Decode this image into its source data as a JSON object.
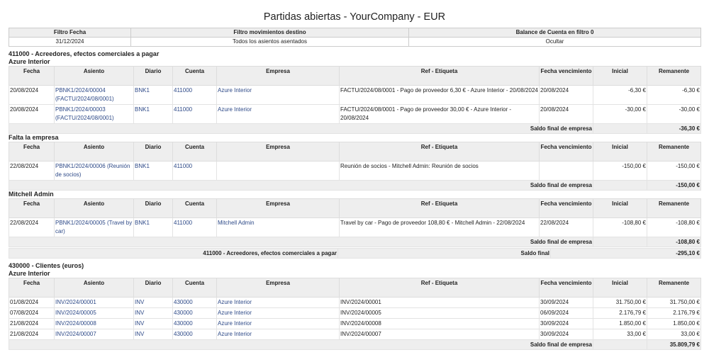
{
  "title": "Partidas abiertas - YourCompany - EUR",
  "filters": {
    "headers": [
      "Filtro Fecha",
      "Filtro movimientos destino",
      "Balance de Cuenta en filtro 0"
    ],
    "values": [
      "31/12/2024",
      "Todos los asientos asentados",
      "Ocultar"
    ]
  },
  "columns": [
    "Fecha",
    "Asiento",
    "Diario",
    "Cuenta",
    "Empresa",
    "Ref - Etiqueta",
    "Fecha vencimiento",
    "Inicial",
    "Remanente"
  ],
  "labels": {
    "partner_total": "Saldo final de empresa",
    "account_total": "Saldo final"
  },
  "accounts": [
    {
      "code": "411000",
      "name": "- Acreedores, efectos comerciales a pagar",
      "total_label": "411000 - Acreedores, efectos comerciales a pagar",
      "total": "-295,10 €",
      "partners": [
        {
          "name": "Azure Interior",
          "total": "-36,30 €",
          "rows": [
            {
              "fecha": "20/08/2024",
              "asiento": "PBNK1/2024/00004 (FACTU/2024/08/0001)",
              "diario": "BNK1",
              "cuenta": "411000",
              "empresa": "Azure Interior",
              "ref": "FACTU/2024/08/0001 - Pago de proveedor 6,30 € - Azure Interior - 20/08/2024",
              "venc": "20/08/2024",
              "inicial": "-6,30 €",
              "remanente": "-6,30 €"
            },
            {
              "fecha": "20/08/2024",
              "asiento": "PBNK1/2024/00003 (FACTU/2024/08/0001)",
              "diario": "BNK1",
              "cuenta": "411000",
              "empresa": "Azure Interior",
              "ref": "FACTU/2024/08/0001 - Pago de proveedor 30,00 € - Azure Interior - 20/08/2024",
              "venc": "20/08/2024",
              "inicial": "-30,00 €",
              "remanente": "-30,00 €"
            }
          ]
        },
        {
          "name": "Falta la empresa",
          "total": "-150,00 €",
          "rows": [
            {
              "fecha": "22/08/2024",
              "asiento": "PBNK1/2024/00006 (Reunión de socios)",
              "diario": "BNK1",
              "cuenta": "411000",
              "empresa": "",
              "ref": "Reunión de socios - Mitchell Admin: Reunión de socios",
              "venc": "",
              "inicial": "-150,00 €",
              "remanente": "-150,00 €"
            }
          ]
        },
        {
          "name": "Mitchell Admin",
          "total": "-108,80 €",
          "rows": [
            {
              "fecha": "22/08/2024",
              "asiento": "PBNK1/2024/00005 (Travel by car)",
              "diario": "BNK1",
              "cuenta": "411000",
              "empresa": "Mitchell Admin",
              "ref": "Travel by car - Pago de proveedor 108,80 € - Mitchell Admin - 22/08/2024",
              "venc": "22/08/2024",
              "inicial": "-108,80 €",
              "remanente": "-108,80 €"
            }
          ]
        }
      ]
    },
    {
      "code": "430000",
      "name": "- Clientes (euros)",
      "total_label": "",
      "total": "",
      "partners": [
        {
          "name": "Azure Interior",
          "total": "35.809,79 €",
          "rows": [
            {
              "fecha": "01/08/2024",
              "asiento": "INV/2024/00001",
              "diario": "INV",
              "cuenta": "430000",
              "empresa": "Azure Interior",
              "ref": "INV/2024/00001",
              "venc": "30/09/2024",
              "inicial": "31.750,00 €",
              "remanente": "31.750,00 €"
            },
            {
              "fecha": "07/08/2024",
              "asiento": "INV/2024/00005",
              "diario": "INV",
              "cuenta": "430000",
              "empresa": "Azure Interior",
              "ref": "INV/2024/00005",
              "venc": "06/09/2024",
              "inicial": "2.176,79 €",
              "remanente": "2.176,79 €"
            },
            {
              "fecha": "21/08/2024",
              "asiento": "INV/2024/00008",
              "diario": "INV",
              "cuenta": "430000",
              "empresa": "Azure Interior",
              "ref": "INV/2024/00008",
              "venc": "30/09/2024",
              "inicial": "1.850,00 €",
              "remanente": "1.850,00 €"
            },
            {
              "fecha": "21/08/2024",
              "asiento": "INV/2024/00007",
              "diario": "INV",
              "cuenta": "430000",
              "empresa": "Azure Interior",
              "ref": "INV/2024/00007",
              "venc": "30/09/2024",
              "inicial": "33,00 €",
              "remanente": "33,00 €"
            }
          ]
        }
      ]
    }
  ]
}
